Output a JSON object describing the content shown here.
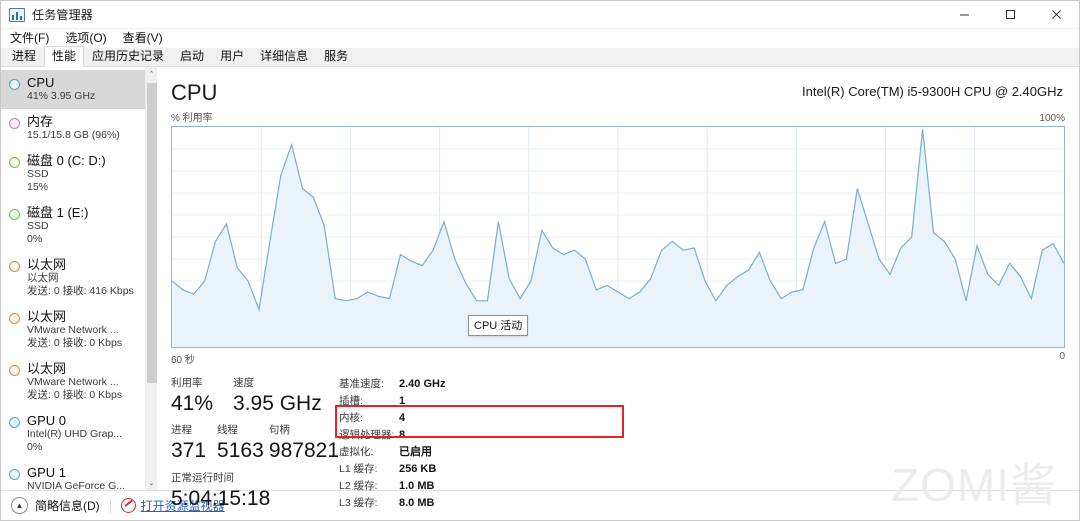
{
  "window": {
    "title": "任务管理器",
    "app_icon": "task-manager-icon",
    "minimize_label": "—",
    "maximize_label": "□",
    "close_label": "✕"
  },
  "menubar": {
    "items": [
      {
        "label": "文件(F)"
      },
      {
        "label": "选项(O)"
      },
      {
        "label": "查看(V)"
      }
    ]
  },
  "tabs": [
    {
      "label": "进程",
      "active": false
    },
    {
      "label": "性能",
      "active": true
    },
    {
      "label": "应用历史记录",
      "active": false
    },
    {
      "label": "启动",
      "active": false
    },
    {
      "label": "用户",
      "active": false
    },
    {
      "label": "详细信息",
      "active": false
    },
    {
      "label": "服务",
      "active": false
    }
  ],
  "sidebar": {
    "items": [
      {
        "name": "cpu",
        "title": "CPU",
        "lines": [
          "41%  3.95 GHz"
        ],
        "color": "#4aa8e0",
        "selected": true
      },
      {
        "name": "memory",
        "title": "内存",
        "lines": [
          "15.1/15.8 GB (96%)"
        ],
        "color": "#c07ed8",
        "selected": false
      },
      {
        "name": "disk-0",
        "title": "磁盘 0 (C: D:)",
        "lines": [
          "SSD",
          "15%"
        ],
        "color": "#6fbf4a",
        "selected": false
      },
      {
        "name": "disk-1",
        "title": "磁盘 1 (E:)",
        "lines": [
          "SSD",
          "0%"
        ],
        "color": "#6fbf4a",
        "selected": false
      },
      {
        "name": "ethernet-0",
        "title": "以太网",
        "lines": [
          "以太网",
          "发送: 0 接收: 416 Kbps"
        ],
        "color": "#e08a3c",
        "selected": false
      },
      {
        "name": "ethernet-1",
        "title": "以太网",
        "lines": [
          "VMware Network ...",
          "发送: 0 接收: 0 Kbps"
        ],
        "color": "#e08a3c",
        "selected": false
      },
      {
        "name": "ethernet-2",
        "title": "以太网",
        "lines": [
          "VMware Network ...",
          "发送: 0 接收: 0 Kbps"
        ],
        "color": "#e08a3c",
        "selected": false
      },
      {
        "name": "gpu-0",
        "title": "GPU 0",
        "lines": [
          "Intel(R) UHD Grap...",
          "0%"
        ],
        "color": "#4aa8e0",
        "selected": false
      },
      {
        "name": "gpu-1",
        "title": "GPU 1",
        "lines": [
          "NVIDIA GeForce G..."
        ],
        "color": "#4aa8e0",
        "selected": false
      }
    ],
    "scroll_up": "⌃",
    "scroll_down": "⌄"
  },
  "main": {
    "title": "CPU",
    "cpu_model": "Intel(R) Core(TM) i5-9300H CPU @ 2.40GHz",
    "y_axis_label": "% 利用率",
    "y_axis_max": "100%",
    "x_axis_left": "60 秒",
    "x_axis_right": "0",
    "tooltip": "CPU 活动"
  },
  "chart_data": {
    "type": "area",
    "title": "CPU 利用率",
    "xlabel": "60 秒",
    "ylabel": "% 利用率",
    "ylim": [
      0,
      100
    ],
    "grid": true,
    "line_color": "#7aadd0",
    "fill_color": "#eaf3fa",
    "series": [
      {
        "name": "CPU 活动",
        "values": [
          30,
          26,
          24,
          30,
          48,
          56,
          36,
          30,
          17,
          48,
          78,
          92,
          72,
          68,
          55,
          22,
          21,
          22,
          25,
          23,
          22,
          42,
          39,
          37,
          44,
          57,
          40,
          29,
          21,
          21,
          57,
          31,
          22,
          30,
          53,
          45,
          42,
          44,
          40,
          26,
          28,
          25,
          22,
          25,
          31,
          44,
          48,
          44,
          45,
          30,
          21,
          28,
          32,
          35,
          43,
          30,
          22,
          25,
          26,
          45,
          57,
          38,
          40,
          72,
          56,
          40,
          33,
          45,
          50,
          99,
          52,
          48,
          40,
          21,
          46,
          33,
          28,
          38,
          32,
          22,
          44,
          47,
          38
        ]
      }
    ]
  },
  "stats": {
    "left": [
      {
        "label": "利用率",
        "value": "41%"
      },
      {
        "label": "速度",
        "value": "3.95 GHz"
      },
      {
        "label": "进程",
        "value": "371"
      },
      {
        "label": "线程",
        "value": "5163"
      },
      {
        "label": "句柄",
        "value": "987821"
      },
      {
        "label": "正常运行时间",
        "value": "5:04:15:18"
      }
    ],
    "details": [
      {
        "key": "基准速度:",
        "value": "2.40 GHz"
      },
      {
        "key": "插槽:",
        "value": "1"
      },
      {
        "key": "内核:",
        "value": "4"
      },
      {
        "key": "逻辑处理器:",
        "value": "8"
      },
      {
        "key": "虚拟化:",
        "value": "已启用"
      },
      {
        "key": "L1 缓存:",
        "value": "256 KB"
      },
      {
        "key": "L2 缓存:",
        "value": "1.0 MB"
      },
      {
        "key": "L3 缓存:",
        "value": "8.0 MB"
      }
    ],
    "highlight_color": "#e8202a"
  },
  "watermark": {
    "text": "ZOMI酱"
  },
  "statusbar": {
    "collapse_label": "简略信息(D)",
    "resource_monitor_label": "打开资源监视器"
  }
}
